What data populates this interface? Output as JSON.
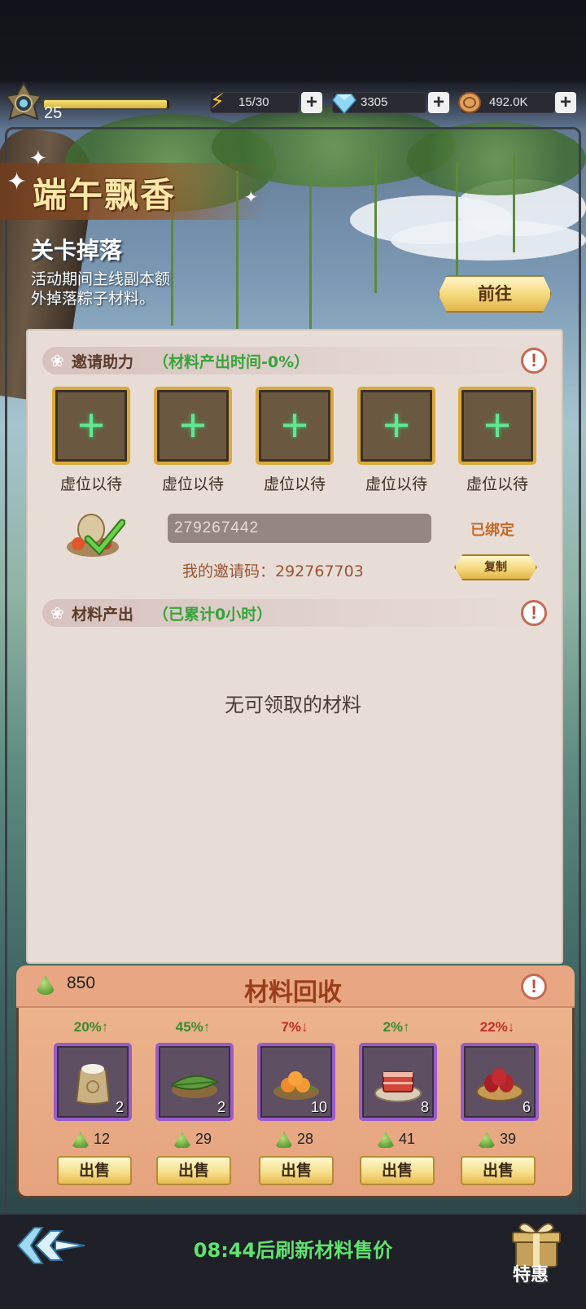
{
  "header": {
    "level": "25",
    "xp_fraction": 0.98,
    "energy": "15/30",
    "gems": "3305",
    "coins": "492.0K",
    "icons": {
      "energy": "lightning-icon",
      "gems": "diamond-icon",
      "coins": "coin-icon"
    }
  },
  "banner": {
    "event_title": "端午飘香",
    "drop_title": "关卡掉落",
    "drop_desc_line1": "活动期间主线副本额",
    "drop_desc_line2": "外掉落粽子材料。",
    "goto_label": "前往"
  },
  "invite": {
    "title": "邀请助力",
    "note": "（材料产出时间-0%）",
    "slot_label": "虚位以待",
    "slots": [
      "虚位以待",
      "虚位以待",
      "虚位以待",
      "虚位以待",
      "虚位以待"
    ],
    "code_input": "279267442",
    "bound_label": "已绑定",
    "my_code_label": "我的邀请码：292767703",
    "copy_label": "复制"
  },
  "output": {
    "title": "材料产出",
    "note": "（已累计0小时）",
    "empty_msg": "无可领取的材料"
  },
  "recycle": {
    "title": "材料回收",
    "zongzi_count": "850",
    "sell_label": "出售",
    "items": [
      {
        "name": "rice",
        "pct": "20%↑",
        "trend": "up",
        "qty": "2",
        "price": "12",
        "color": "#c8b182"
      },
      {
        "name": "bamboo-leaves",
        "pct": "45%↑",
        "trend": "up",
        "qty": "2",
        "price": "29",
        "color": "#5e9a3e"
      },
      {
        "name": "oranges",
        "pct": "7%↓",
        "trend": "down",
        "qty": "10",
        "price": "28",
        "color": "#ee8b2a"
      },
      {
        "name": "pork",
        "pct": "2%↑",
        "trend": "up",
        "qty": "8",
        "price": "41",
        "color": "#d2463a"
      },
      {
        "name": "red-dates",
        "pct": "22%↓",
        "trend": "down",
        "qty": "6",
        "price": "39",
        "color": "#a81e24"
      }
    ]
  },
  "footer": {
    "refresh_text": "08:44后刷新材料售价",
    "gift_label": "特惠"
  }
}
